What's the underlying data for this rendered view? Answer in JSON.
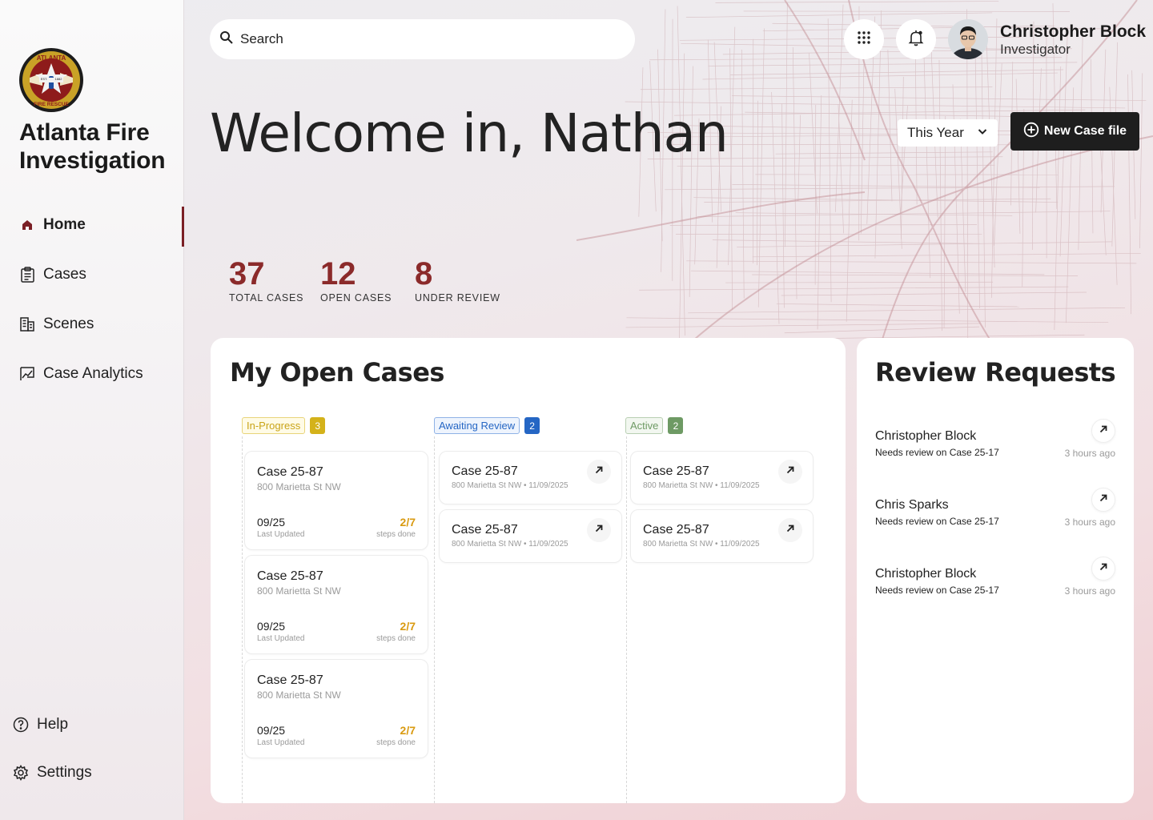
{
  "brand": {
    "line1": "Atlanta Fire",
    "line2": "Investigation",
    "logo_text_top": "ATLANTA",
    "logo_text_bottom": "FIRE RESCUE",
    "logo_est": "EST.",
    "logo_year": "1882"
  },
  "nav": [
    {
      "label": "Home",
      "icon": "home-icon",
      "active": true
    },
    {
      "label": "Cases",
      "icon": "clipboard-icon"
    },
    {
      "label": "Scenes",
      "icon": "building-icon"
    },
    {
      "label": "Case Analytics",
      "icon": "chart-icon"
    }
  ],
  "nav_bottom": [
    {
      "label": "Help",
      "icon": "help-icon"
    },
    {
      "label": "Settings",
      "icon": "gear-icon"
    }
  ],
  "search": {
    "placeholder": "Search"
  },
  "user": {
    "name": "Christopher Block",
    "role": "Investigator"
  },
  "welcome": "Welcome in, Nathan",
  "filter": {
    "selected": "This Year"
  },
  "new_case_label": "New Case file",
  "stats": [
    {
      "value": "37",
      "label": "TOTAL CASES"
    },
    {
      "value": "12",
      "label": "OPEN CASES"
    },
    {
      "value": "8",
      "label": "UNDER REVIEW"
    }
  ],
  "open_cases": {
    "title": "My Open Cases",
    "columns": [
      {
        "label": "In-Progress",
        "count": "3",
        "color": "#d4b21a"
      },
      {
        "label": "Awaiting Review",
        "count": "2",
        "color": "#2566c4"
      },
      {
        "label": "Active",
        "count": "2",
        "color": "#6e9a64"
      }
    ],
    "in_progress": [
      {
        "title": "Case 25-87",
        "address": "800 Marietta St NW",
        "date": "09/25",
        "date_label": "Last Updated",
        "steps": "2/7",
        "steps_label": "steps done"
      },
      {
        "title": "Case 25-87",
        "address": "800 Marietta St NW",
        "date": "09/25",
        "date_label": "Last Updated",
        "steps": "2/7",
        "steps_label": "steps done"
      },
      {
        "title": "Case 25-87",
        "address": "800 Marietta St NW",
        "date": "09/25",
        "date_label": "Last Updated",
        "steps": "2/7",
        "steps_label": "steps done"
      }
    ],
    "awaiting": [
      {
        "title": "Case 25-87",
        "meta": "800 Marietta St NW  •  11/09/2025"
      },
      {
        "title": "Case 25-87",
        "meta": "800 Marietta St NW  •  11/09/2025"
      }
    ],
    "active": [
      {
        "title": "Case 25-87",
        "meta": "800 Marietta St NW  •  11/09/2025"
      },
      {
        "title": "Case 25-87",
        "meta": "800 Marietta St NW  •  11/09/2025"
      }
    ]
  },
  "review_requests": {
    "title": "Review Requests",
    "items": [
      {
        "name": "Christopher Block",
        "sub": "Needs review on Case 25-17",
        "time": "3 hours ago"
      },
      {
        "name": "Chris Sparks",
        "sub": "Needs review on Case 25-17",
        "time": "3 hours ago"
      },
      {
        "name": "Christopher Block",
        "sub": "Needs review on Case 25-17",
        "time": "3 hours ago"
      }
    ]
  }
}
